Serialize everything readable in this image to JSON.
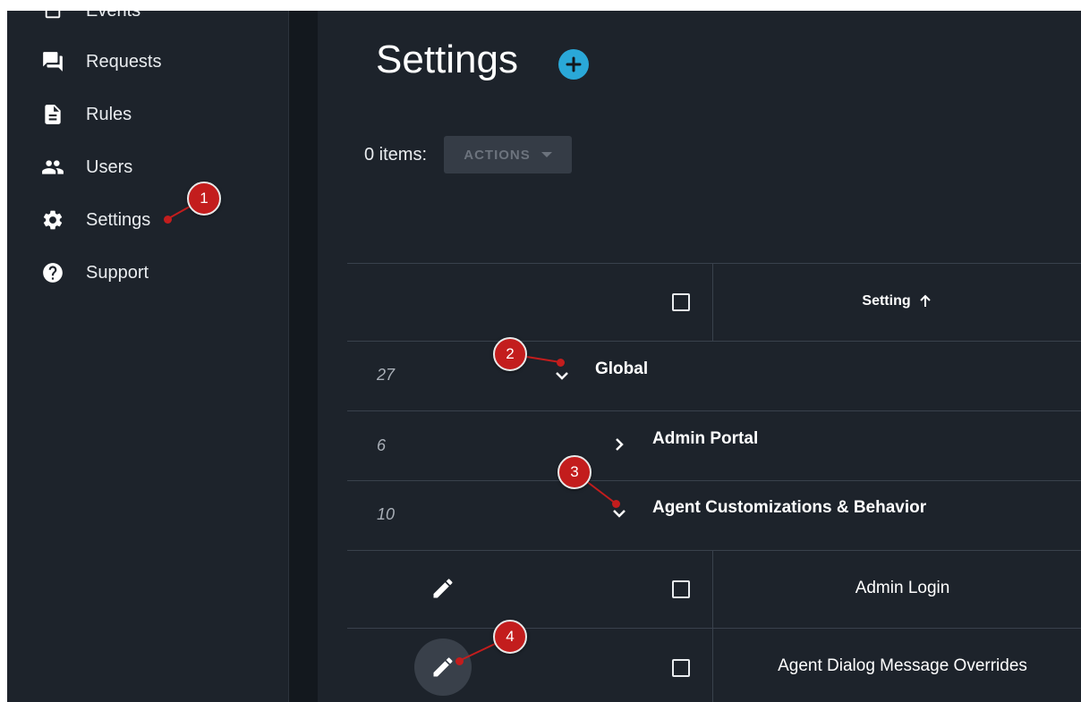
{
  "sidebar": {
    "items": [
      {
        "label": "Events",
        "icon": "events-icon"
      },
      {
        "label": "Requests",
        "icon": "forum-icon"
      },
      {
        "label": "Rules",
        "icon": "document-icon"
      },
      {
        "label": "Users",
        "icon": "people-icon"
      },
      {
        "label": "Settings",
        "icon": "gear-icon"
      },
      {
        "label": "Support",
        "icon": "help-circle-icon"
      }
    ]
  },
  "main": {
    "title": "Settings",
    "items_count": "0 items:",
    "actions_label": "ACTIONS"
  },
  "table": {
    "column_header": "Setting",
    "groups": [
      {
        "count": "27",
        "title": "Global"
      },
      {
        "count": "6",
        "title": "Admin Portal"
      },
      {
        "count": "10",
        "title": "Agent Customizations & Behavior"
      }
    ],
    "rows": [
      {
        "setting": "Admin Login"
      },
      {
        "setting": "Agent Dialog Message Overrides"
      }
    ]
  },
  "annotations": [
    "1",
    "2",
    "3",
    "4"
  ],
  "colors": {
    "background": "#1d232b",
    "gutter": "#13181e",
    "accent": "#2aa8d8",
    "marker": "#c31d1d"
  }
}
